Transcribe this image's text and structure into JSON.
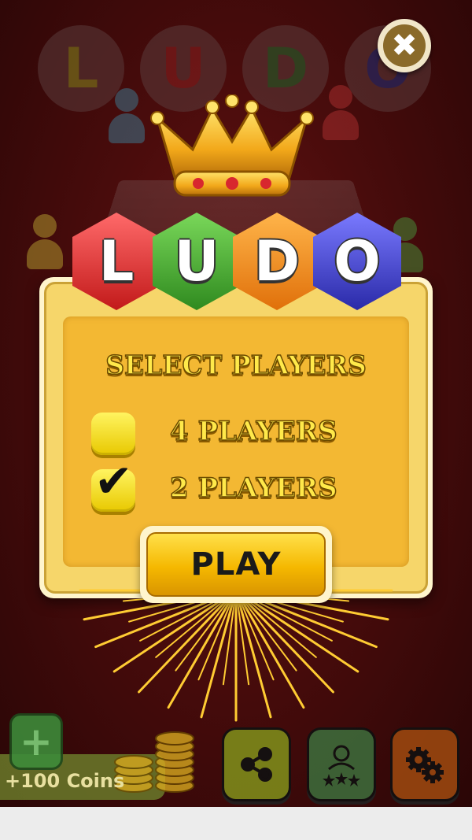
{
  "game": {
    "logo_letters": [
      "L",
      "U",
      "D",
      "O"
    ],
    "logo_colors": [
      "#d32f2f",
      "#3fa535",
      "#f08a1c",
      "#3b3fb8"
    ],
    "select_title": "SELECT PLAYERS",
    "options": [
      {
        "label": "4 PLAYERS",
        "checked": false
      },
      {
        "label": "2 PLAYERS",
        "checked": true
      }
    ],
    "check_glyph": "✔",
    "play_label": "PLAY",
    "close_glyph": "✖",
    "coins_label": "+100 Coins",
    "add_glyph": "+"
  },
  "toolbar": {
    "icons": [
      "add-coins-icon",
      "share-icon",
      "leaderboard-icon",
      "settings-icon"
    ]
  },
  "colors": {
    "panel": "#f3b833",
    "title_text": "#ffe94a",
    "play_button": "#f5b800"
  }
}
